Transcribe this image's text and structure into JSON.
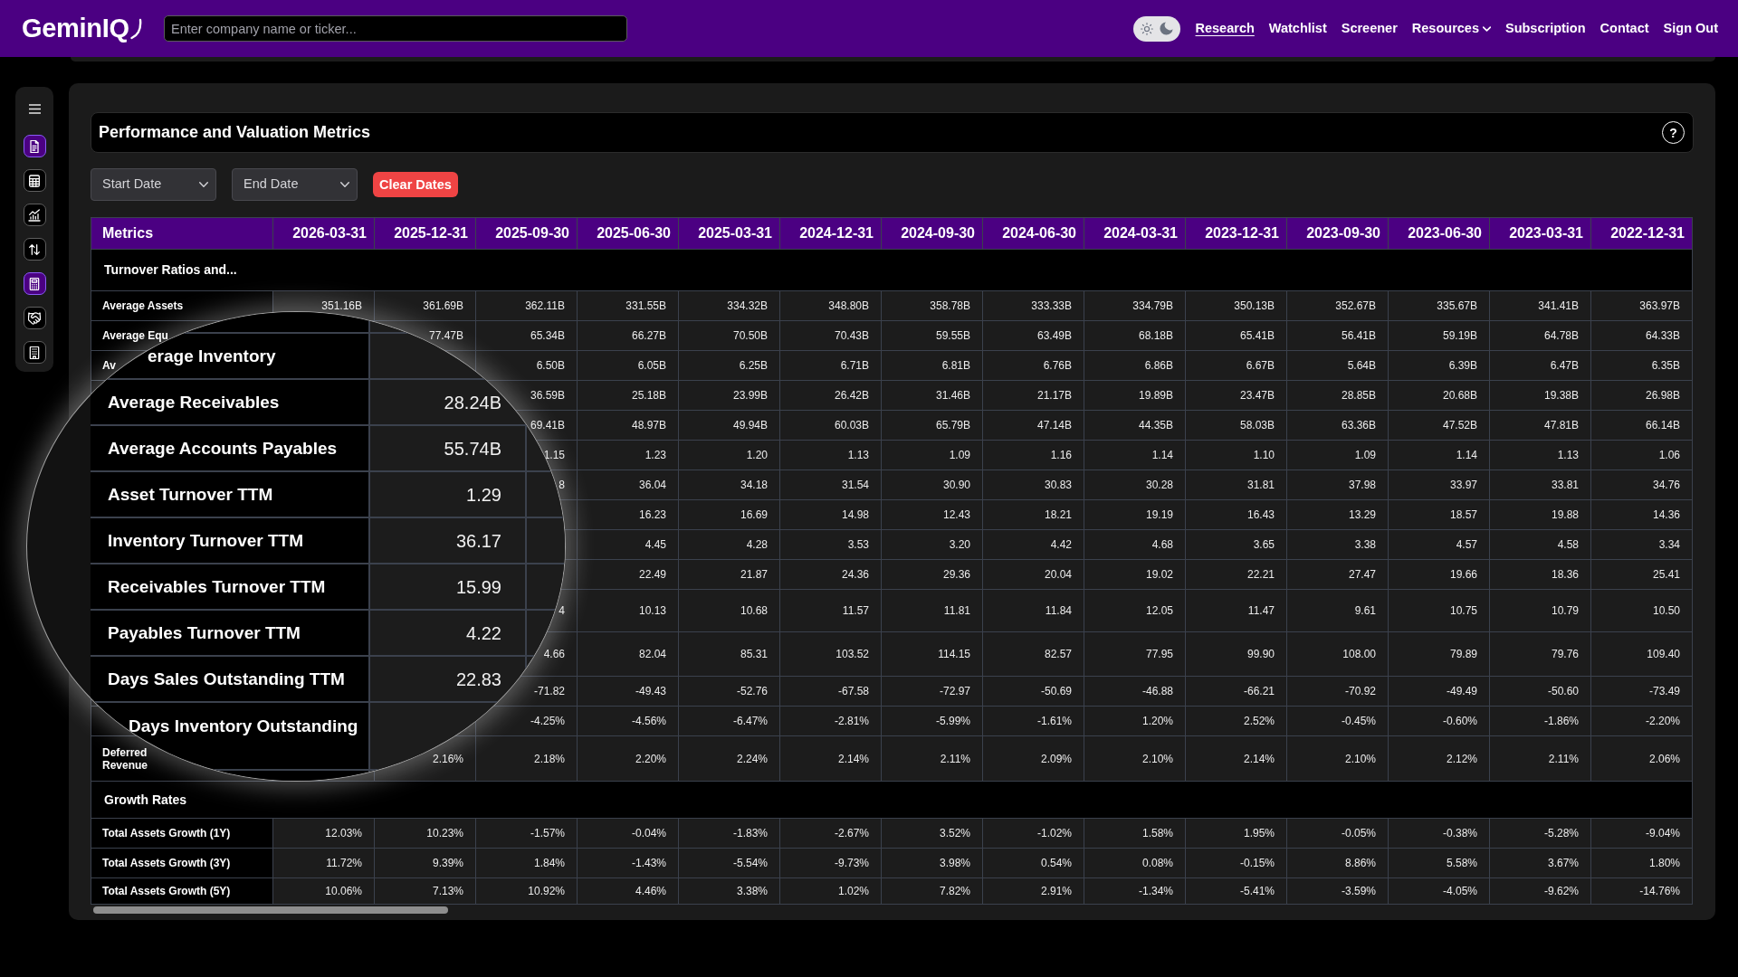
{
  "nav": {
    "logo": "GeminIQ",
    "search": {
      "placeholder": "Enter company name or ticker..."
    },
    "theme_toggle": {
      "dark": true
    },
    "links": [
      {
        "label": "Research",
        "selected": true,
        "kind": "link"
      },
      {
        "label": "Watchlist",
        "selected": false,
        "kind": "link"
      },
      {
        "label": "Screener",
        "selected": false,
        "kind": "link"
      },
      {
        "label": "Resources",
        "selected": false,
        "kind": "dropdown"
      },
      {
        "label": "Subscription",
        "selected": false,
        "kind": "link"
      },
      {
        "label": "Contact",
        "selected": false,
        "kind": "link"
      },
      {
        "label": "Sign Out",
        "selected": false,
        "kind": "link"
      }
    ]
  },
  "sidebar": {
    "items": [
      {
        "selected": true
      },
      {
        "selected": false
      },
      {
        "selected": false
      },
      {
        "selected": false
      },
      {
        "selected": true
      },
      {
        "selected": false
      },
      {
        "selected": false
      }
    ]
  },
  "panel": {
    "title": "Performance and Valuation Metrics",
    "help_button": "?",
    "filters": [
      {
        "label": "Start Date"
      },
      {
        "label": "End Date"
      }
    ],
    "clear_button": "Clear Dates",
    "table": {
      "columns": [
        "Metrics",
        "2026-03-31",
        "2025-12-31",
        "2025-09-30",
        "2025-06-30",
        "2025-03-31",
        "2024-12-31",
        "2024-09-30",
        "2024-06-30",
        "2024-03-31",
        "2023-12-31",
        "2023-09-30",
        "2023-06-30",
        "2023-03-31",
        "2022-12-31"
      ],
      "rows": [
        {
          "kind": "section",
          "label": "Turnover Ratios and..."
        },
        {
          "kind": "data",
          "label": "Average Assets",
          "values": [
            "351.16B",
            "361.69B",
            "362.11B",
            "331.55B",
            "334.32B",
            "348.80B",
            "358.78B",
            "333.33B",
            "334.79B",
            "350.13B",
            "352.67B",
            "335.67B",
            "341.41B",
            "363.97B"
          ]
        },
        {
          "kind": "data",
          "label": "Average Equ",
          "values": [
            "77.47B",
            "65.34B",
            "66.27B",
            "70.50B",
            "70.43B",
            "59.55B",
            "63.49B",
            "68.18B",
            "65.41B",
            "56.41B",
            "59.19B",
            "64.78B",
            "64.33B"
          ]
        },
        {
          "kind": "data",
          "label": "Av",
          "values": [
            "6.50B",
            "6.05B",
            "6.25B",
            "6.71B",
            "6.81B",
            "6.76B",
            "6.86B",
            "6.67B",
            "5.64B",
            "6.39B",
            "6.47B",
            "6.35B"
          ]
        },
        {
          "kind": "data",
          "values": [
            "36.59B",
            "25.18B",
            "23.99B",
            "26.42B",
            "31.46B",
            "21.17B",
            "19.89B",
            "23.47B",
            "28.85B",
            "20.68B",
            "19.38B",
            "26.98B"
          ]
        },
        {
          "kind": "data",
          "values": [
            "69.41B",
            "48.97B",
            "49.94B",
            "60.03B",
            "65.79B",
            "47.14B",
            "44.35B",
            "58.03B",
            "63.36B",
            "47.52B",
            "47.81B",
            "66.14B"
          ]
        },
        {
          "kind": "data",
          "values": [
            "1.15",
            "1.23",
            "1.20",
            "1.13",
            "1.09",
            "1.16",
            "1.14",
            "1.10",
            "1.09",
            "1.14",
            "1.13",
            "1.06"
          ]
        },
        {
          "kind": "data",
          "values": [
            "8",
            "36.04",
            "34.18",
            "31.54",
            "30.90",
            "30.83",
            "30.28",
            "31.81",
            "37.98",
            "33.97",
            "33.81",
            "34.76"
          ]
        },
        {
          "kind": "data",
          "values": [
            "16.23",
            "16.69",
            "14.98",
            "12.43",
            "18.21",
            "19.19",
            "16.43",
            "13.29",
            "18.57",
            "19.88",
            "14.36"
          ]
        },
        {
          "kind": "data",
          "values": [
            "4.45",
            "4.28",
            "3.53",
            "3.20",
            "4.42",
            "4.68",
            "3.65",
            "3.38",
            "4.57",
            "4.58",
            "3.34"
          ]
        },
        {
          "kind": "data",
          "values": [
            "22.49",
            "21.87",
            "24.36",
            "29.36",
            "20.04",
            "19.02",
            "22.21",
            "27.47",
            "19.66",
            "18.36",
            "25.41"
          ]
        },
        {
          "kind": "data",
          "values": [
            "4",
            "10.13",
            "10.68",
            "11.57",
            "11.81",
            "11.84",
            "12.05",
            "11.47",
            "9.61",
            "10.75",
            "10.79",
            "10.50"
          ]
        },
        {
          "kind": "data",
          "values": [
            "4.66",
            "82.04",
            "85.31",
            "103.52",
            "114.15",
            "82.57",
            "77.95",
            "99.90",
            "108.00",
            "79.89",
            "79.76",
            "109.40"
          ]
        },
        {
          "kind": "data",
          "values": [
            "-71.82",
            "-49.43",
            "-52.76",
            "-67.58",
            "-72.97",
            "-50.69",
            "-46.88",
            "-66.21",
            "-70.92",
            "-49.49",
            "-50.60",
            "-73.49"
          ]
        },
        {
          "kind": "data",
          "values": [
            "-4.25%",
            "-4.56%",
            "-6.47%",
            "-2.81%",
            "-5.99%",
            "-1.61%",
            "1.20%",
            "2.52%",
            "-0.45%",
            "-0.60%",
            "-1.86%",
            "-2.20%"
          ]
        },
        {
          "kind": "data",
          "label": "Deferred\nRevenue",
          "values": [
            "2.16%",
            "2.18%",
            "2.20%",
            "2.24%",
            "2.14%",
            "2.11%",
            "2.09%",
            "2.10%",
            "2.14%",
            "2.10%",
            "2.12%",
            "2.11%",
            "2.06%"
          ]
        },
        {
          "kind": "section",
          "label": "Growth Rates"
        },
        {
          "kind": "data",
          "label": "Total Assets Growth (1Y)",
          "values": [
            "12.03%",
            "10.23%",
            "-1.57%",
            "-0.04%",
            "-1.83%",
            "-2.67%",
            "3.52%",
            "-1.02%",
            "1.58%",
            "1.95%",
            "-0.05%",
            "-0.38%",
            "-5.28%",
            "-9.04%"
          ]
        },
        {
          "kind": "data",
          "label": "Total Assets Growth (3Y)",
          "values": [
            "11.72%",
            "9.39%",
            "1.84%",
            "-1.43%",
            "-5.54%",
            "-9.73%",
            "3.98%",
            "0.54%",
            "0.08%",
            "-0.15%",
            "8.86%",
            "5.58%",
            "3.67%",
            "1.80%"
          ]
        },
        {
          "kind": "data",
          "label": "Total Assets Growth (5Y)",
          "values": [
            "10.06%",
            "7.13%",
            "10.92%",
            "4.46%",
            "3.38%",
            "1.02%",
            "7.82%",
            "2.91%",
            "-1.34%",
            "-5.41%",
            "-3.59%",
            "-4.05%",
            "-9.62%",
            "-14.76%"
          ]
        }
      ]
    },
    "magnifier": {
      "rows": [
        {
          "label": "erage Inventory"
        },
        {
          "label": "Average Receivables",
          "value": "28.24B"
        },
        {
          "label": "Average Accounts Payables",
          "value": "55.74B"
        },
        {
          "label": "Asset Turnover TTM",
          "value": "1.29"
        },
        {
          "label": "Inventory Turnover TTM",
          "value": "36.17"
        },
        {
          "label": "Receivables Turnover TTM",
          "value": "15.99"
        },
        {
          "label": "Payables Turnover TTM",
          "value": "4.22"
        },
        {
          "label": "Days Sales Outstanding TTM",
          "value": "22.83"
        },
        {
          "label": "Days Inventory Outstanding"
        }
      ]
    }
  }
}
